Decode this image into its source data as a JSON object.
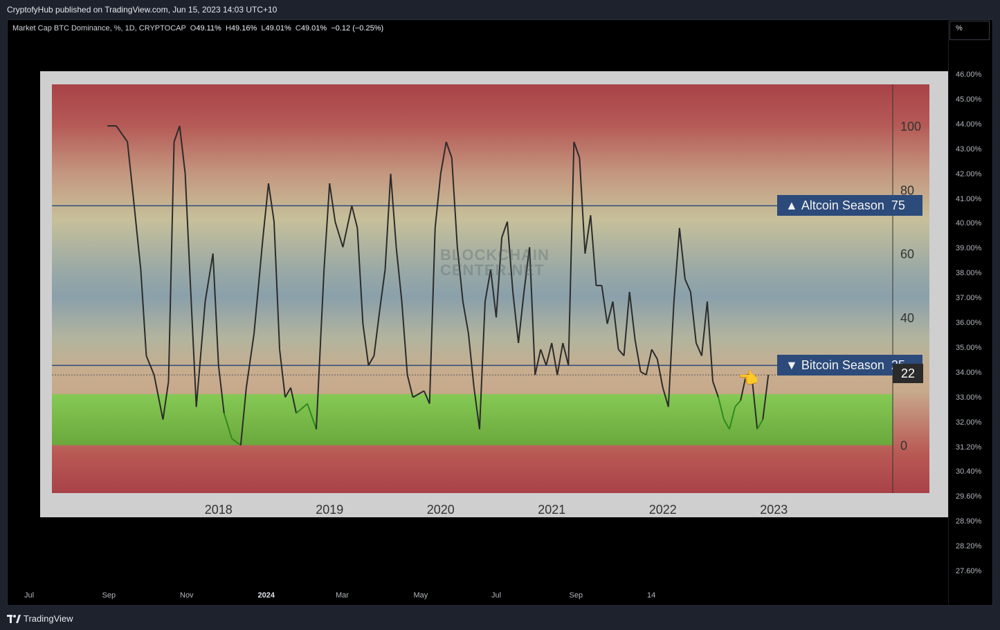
{
  "header": {
    "published": "CryptofyHub published on TradingView.com, Jun 15, 2023 14:03 UTC+10"
  },
  "legend": {
    "symbol": "Market Cap BTC Dominance, %, 1D, CRYPTOCAP",
    "o_label": "O",
    "o_value": "49.11%",
    "h_label": "H",
    "h_value": "49.16%",
    "l_label": "L",
    "l_value": "49.01%",
    "c_label": "C",
    "c_value": "49.01%",
    "change": "−0.12 (−0.25%)"
  },
  "scale_button": "%",
  "price_axis": [
    "46.00%",
    "45.00%",
    "44.00%",
    "43.00%",
    "42.00%",
    "41.00%",
    "40.00%",
    "39.00%",
    "38.00%",
    "37.00%",
    "36.00%",
    "35.00%",
    "34.00%",
    "33.00%",
    "32.00%",
    "31.20%",
    "30.40%",
    "29.60%",
    "28.90%",
    "28.20%",
    "27.60%"
  ],
  "time_axis": [
    {
      "label": "Jul",
      "bold": false
    },
    {
      "label": "Sep",
      "bold": false
    },
    {
      "label": "Nov",
      "bold": false
    },
    {
      "label": "2024",
      "bold": true
    },
    {
      "label": "Mar",
      "bold": false
    },
    {
      "label": "May",
      "bold": false
    },
    {
      "label": "Jul",
      "bold": false
    },
    {
      "label": "Sep",
      "bold": false
    },
    {
      "label": "14",
      "bold": false
    }
  ],
  "footer": {
    "brand": "TradingView"
  },
  "chart_data": {
    "type": "line",
    "title": "",
    "watermark": [
      "BLOCKCHAIN",
      "CENTER.NET"
    ],
    "x_ticks": [
      "2018",
      "2019",
      "2020",
      "2021",
      "2022",
      "2023"
    ],
    "y_ticks": [
      0,
      40,
      60,
      80,
      100
    ],
    "ylim": [
      -15,
      113
    ],
    "grid": false,
    "reference_lines": [
      {
        "label": "Altcoin Season",
        "marker": "▲",
        "value": 75,
        "color": "#2c4a7a"
      },
      {
        "label": "Bitcoin Season",
        "marker": "▼",
        "value": 25,
        "color": "#2c4a7a"
      }
    ],
    "current_value": 22,
    "pointer_icon": "pointing-hand-icon",
    "highlight_band": {
      "from": 0,
      "to": 16,
      "color": "#7bbf4a"
    },
    "series": [
      {
        "color": "#2b2b2b",
        "low_color": "#2f8a1e",
        "x": [
          2017.5,
          2017.58,
          2017.68,
          2017.72,
          2017.8,
          2017.85,
          2017.92,
          2018.0,
          2018.05,
          2018.1,
          2018.15,
          2018.2,
          2018.25,
          2018.3,
          2018.38,
          2018.45,
          2018.5,
          2018.55,
          2018.62,
          2018.7,
          2018.75,
          2018.82,
          2018.9,
          2018.95,
          2019.0,
          2019.05,
          2019.1,
          2019.15,
          2019.2,
          2019.3,
          2019.38,
          2019.45,
          2019.5,
          2019.55,
          2019.62,
          2019.7,
          2019.75,
          2019.8,
          2019.85,
          2019.9,
          2019.95,
          2020.0,
          2020.05,
          2020.1,
          2020.15,
          2020.2,
          2020.25,
          2020.35,
          2020.4,
          2020.45,
          2020.5,
          2020.55,
          2020.6,
          2020.65,
          2020.7,
          2020.75,
          2020.8,
          2020.85,
          2020.9,
          2020.95,
          2021.0,
          2021.05,
          2021.1,
          2021.15,
          2021.2,
          2021.25,
          2021.3,
          2021.35,
          2021.4,
          2021.45,
          2021.5,
          2021.55,
          2021.6,
          2021.65,
          2021.7,
          2021.75,
          2021.8,
          2021.85,
          2021.9,
          2021.95,
          2022.0,
          2022.05,
          2022.1,
          2022.15,
          2022.2,
          2022.25,
          2022.3,
          2022.35,
          2022.4,
          2022.45,
          2022.5,
          2022.55,
          2022.6,
          2022.65,
          2022.7,
          2022.75,
          2022.8,
          2022.85,
          2022.9,
          2022.95,
          2023.0,
          2023.05,
          2023.1,
          2023.15,
          2023.2,
          2023.25,
          2023.3,
          2023.35,
          2023.4,
          2023.45
        ],
        "y": [
          100,
          100,
          95,
          82,
          55,
          28,
          22,
          8,
          20,
          95,
          100,
          85,
          48,
          12,
          45,
          60,
          25,
          10,
          2,
          0,
          18,
          35,
          65,
          82,
          70,
          30,
          15,
          18,
          10,
          13,
          5,
          55,
          82,
          70,
          62,
          75,
          68,
          38,
          25,
          28,
          42,
          55,
          85,
          62,
          45,
          22,
          15,
          17,
          13,
          68,
          85,
          95,
          90,
          62,
          45,
          35,
          18,
          5,
          45,
          55,
          40,
          65,
          70,
          48,
          32,
          48,
          62,
          22,
          30,
          25,
          32,
          22,
          32,
          25,
          95,
          90,
          60,
          72,
          50,
          50,
          38,
          45,
          30,
          28,
          48,
          33,
          23,
          22,
          30,
          27,
          18,
          12,
          45,
          68,
          52,
          48,
          32,
          28,
          45,
          20,
          15,
          8,
          5,
          12,
          14,
          22,
          22,
          5,
          8,
          22
        ]
      }
    ]
  }
}
